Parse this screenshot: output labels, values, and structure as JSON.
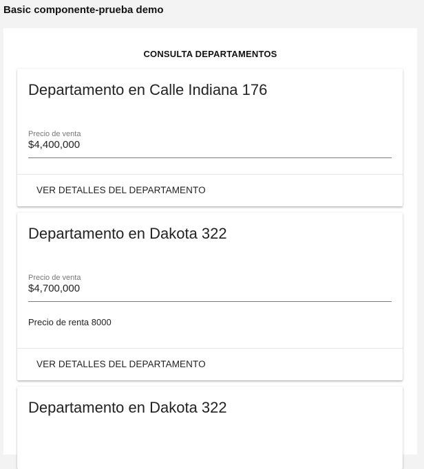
{
  "app": {
    "title": "Basic componente-prueba demo"
  },
  "section": {
    "title": "CONSULTA DEPARTAMENTOS"
  },
  "cards": [
    {
      "title": "Departamento en Calle Indiana 176",
      "price_label": "Precio de venta",
      "price_value": "$4,400,000",
      "action_label": "VER DETALLES DEL DEPARTAMENTO"
    },
    {
      "title": "Departamento en Dakota 322",
      "price_label": "Precio de venta",
      "price_value": "$4,700,000",
      "rent_text": "Precio de renta 8000",
      "action_label": "VER DETALLES DEL DEPARTAMENTO"
    },
    {
      "title": "Departamento en Dakota 322"
    }
  ]
}
